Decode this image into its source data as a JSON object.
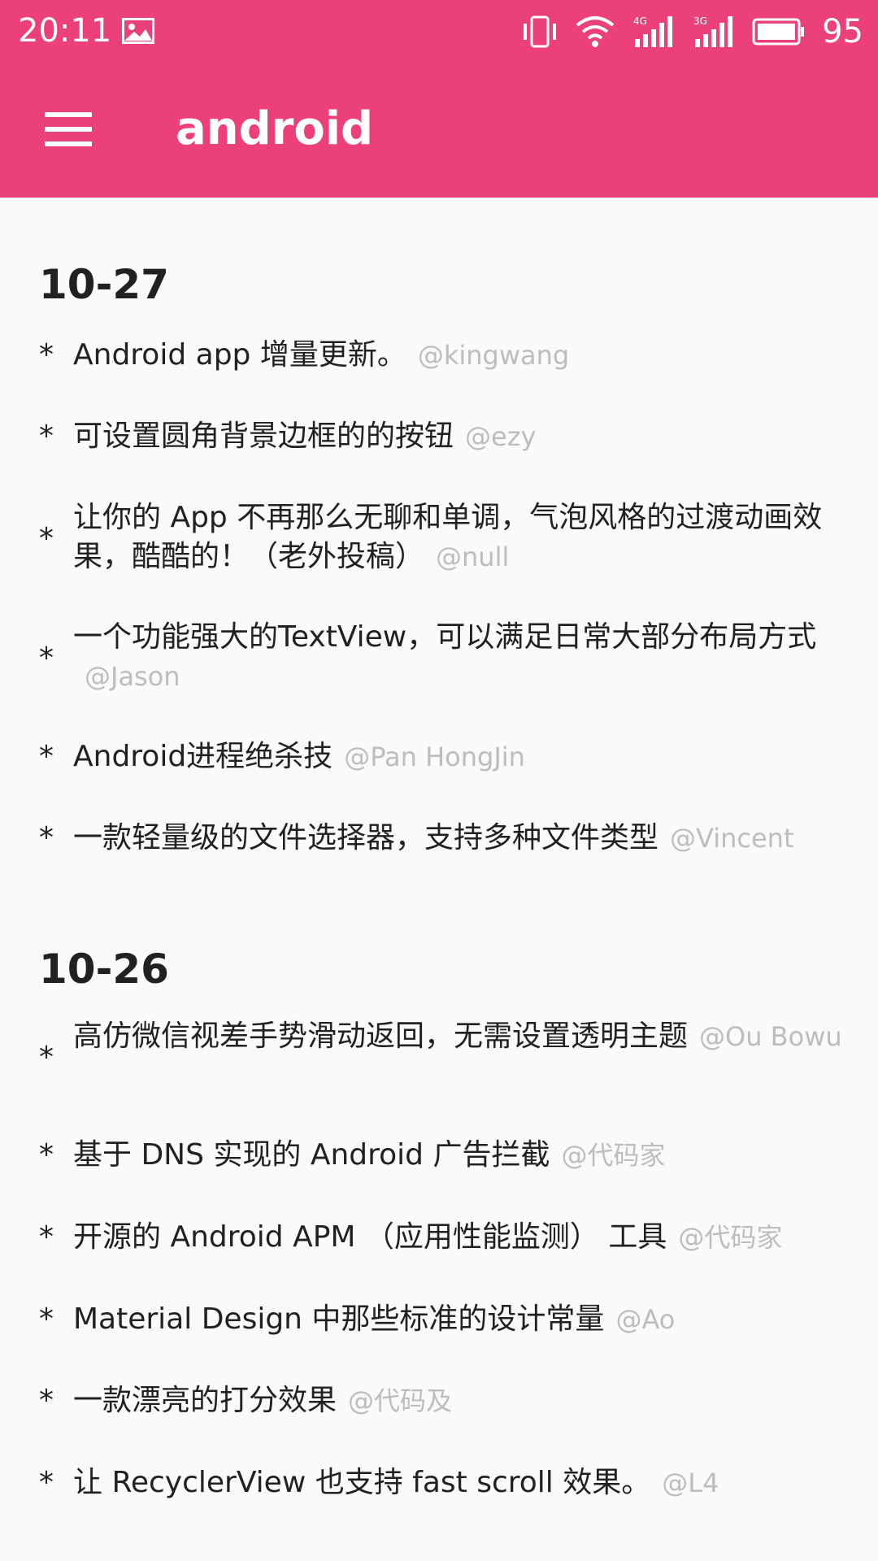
{
  "status_bar": {
    "time": "20:11",
    "battery": "95",
    "icons": [
      "image-icon",
      "vibrate-icon",
      "wifi-icon",
      "signal-4g-icon",
      "signal-3g-icon",
      "battery-icon"
    ],
    "color": "#ec407a"
  },
  "app_bar": {
    "title": "android",
    "menu_icon": "hamburger-menu-icon",
    "color": "#ec407a"
  },
  "sections": [
    {
      "date": "10-27",
      "items": [
        {
          "text": "Android app 增量更新。",
          "author": "@kingwang"
        },
        {
          "text": "可设置圆角背景边框的的按钮",
          "author": "@ezy"
        },
        {
          "text": "让你的 App 不再那么无聊和单调，气泡风格的过渡动画效果，酷酷的！（老外投稿）",
          "author": "@null"
        },
        {
          "text": "一个功能强大的TextView，可以满足日常大部分布局方式",
          "author": "@Jason"
        },
        {
          "text": "Android进程绝杀技",
          "author": "@Pan HongJin"
        },
        {
          "text": "一款轻量级的文件选择器，支持多种文件类型",
          "author": "@Vincent"
        }
      ]
    },
    {
      "date": "10-26",
      "items": [
        {
          "text": "高仿微信视差手势滑动返回，无需设置透明主题",
          "author": "@Ou Bowu"
        },
        {
          "text": "基于 DNS 实现的 Android 广告拦截",
          "author": "@代码家"
        },
        {
          "text": "开源的 Android APM （应用性能监测） 工具",
          "author": "@代码家"
        },
        {
          "text": "Material Design 中那些标准的设计常量",
          "author": "@Ao"
        },
        {
          "text": "一款漂亮的打分效果",
          "author": "@代码及"
        },
        {
          "text": "让 RecyclerView 也支持 fast scroll 效果。",
          "author": "@L4"
        }
      ]
    }
  ]
}
